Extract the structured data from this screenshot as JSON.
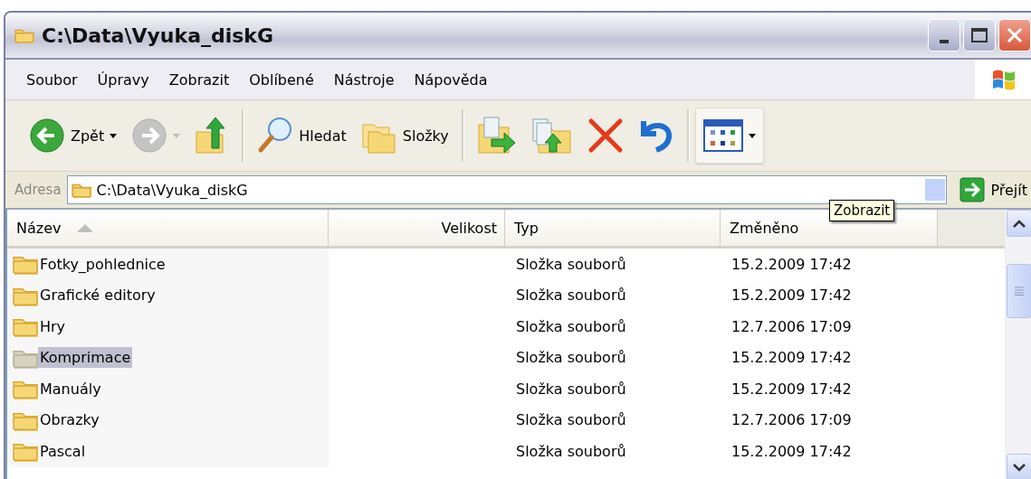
{
  "window": {
    "title": "C:\\Data\\Vyuka_diskG"
  },
  "menu": [
    "Soubor",
    "Úpravy",
    "Zobrazit",
    "Oblíbené",
    "Nástroje",
    "Nápověda"
  ],
  "toolbar": [
    {
      "kind": "back",
      "label": "Zpět",
      "disabled": false
    },
    {
      "kind": "forward",
      "disabled": true
    },
    {
      "kind": "up"
    },
    {
      "kind": "separator"
    },
    {
      "kind": "search",
      "label": "Hledat"
    },
    {
      "kind": "folders",
      "label": "Složky"
    },
    {
      "kind": "separator"
    },
    {
      "kind": "move"
    },
    {
      "kind": "copy"
    },
    {
      "kind": "delete"
    },
    {
      "kind": "undo"
    },
    {
      "kind": "separator"
    },
    {
      "kind": "views"
    }
  ],
  "address": {
    "label": "Adresa",
    "value": "C:\\Data\\Vyuka_diskG",
    "go": "Přejít"
  },
  "tooltip": "Zobrazit",
  "table": {
    "columns": [
      "Název",
      "Velikost",
      "Typ",
      "Změněno"
    ],
    "rows": [
      {
        "name": "Fotky_pohlednice",
        "type": "Složka souborů",
        "modified": "15.2.2009 17:42",
        "selected": false
      },
      {
        "name": "Grafické editory",
        "type": "Složka souborů",
        "modified": "15.2.2009 17:42",
        "selected": false
      },
      {
        "name": "Hry",
        "type": "Složka souborů",
        "modified": "12.7.2006 17:09",
        "selected": false
      },
      {
        "name": "Komprimace",
        "type": "Složka souborů",
        "modified": "15.2.2009 17:42",
        "selected": true
      },
      {
        "name": "Manuály",
        "type": "Složka souborů",
        "modified": "15.2.2009 17:42",
        "selected": false
      },
      {
        "name": "Obrazky",
        "type": "Složka souborů",
        "modified": "12.7.2006 17:09",
        "selected": false
      },
      {
        "name": "Pascal",
        "type": "Složka souborů",
        "modified": "15.2.2009 17:42",
        "selected": false
      }
    ]
  }
}
